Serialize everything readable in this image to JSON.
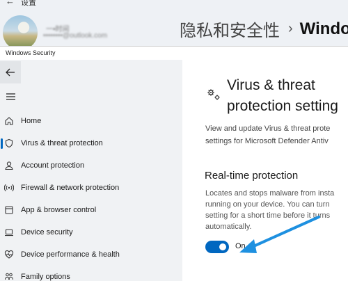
{
  "background_settings": {
    "back_glyph": "←",
    "title": "设置",
    "user_name": "一•时间",
    "user_email": "••••••••@outlook.com",
    "breadcrumb_parent": "隐私和安全性",
    "breadcrumb_separator": "›",
    "breadcrumb_current": "Windo"
  },
  "window": {
    "title": "Windows Security"
  },
  "sidebar": {
    "back_icon": "back-arrow-icon",
    "menu_icon": "hamburger-menu-icon",
    "items": [
      {
        "label": "Home",
        "icon": "home-icon"
      },
      {
        "label": "Virus & threat protection",
        "icon": "shield-icon",
        "active": true
      },
      {
        "label": "Account protection",
        "icon": "person-icon"
      },
      {
        "label": "Firewall & network protection",
        "icon": "wifi-signal-icon"
      },
      {
        "label": "App & browser control",
        "icon": "app-window-icon"
      },
      {
        "label": "Device security",
        "icon": "laptop-icon"
      },
      {
        "label": "Device performance & health",
        "icon": "heart-pulse-icon"
      },
      {
        "label": "Family options",
        "icon": "family-icon"
      }
    ]
  },
  "main": {
    "title_line1": "Virus & threat",
    "title_line2": "protection setting",
    "description_line1": "View and update Virus & threat prote",
    "description_line2": "settings for Microsoft Defender Antiv",
    "realtime": {
      "title": "Real-time protection",
      "desc_line1": "Locates and stops malware from insta",
      "desc_line2": "running on your device. You can turn",
      "desc_line3": "setting for a short time before it turns",
      "desc_line4": "automatically.",
      "toggle_on": true,
      "toggle_label": "On"
    }
  },
  "colors": {
    "accent": "#0067c0",
    "sidebar_bg": "#f0f2f4",
    "annotation_arrow": "#1e90e0"
  }
}
